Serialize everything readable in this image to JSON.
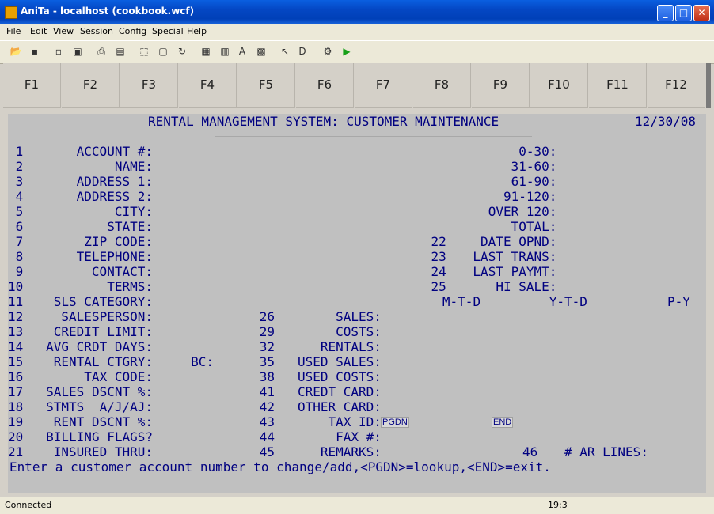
{
  "window": {
    "title": "AniTa -   localhost (cookbook.wcf)"
  },
  "menu": [
    "File",
    "Edit",
    "View",
    "Session",
    "Config",
    "Special",
    "Help"
  ],
  "toolbar_icons": [
    "open-icon",
    "save-icon",
    "copy-icon",
    "paste-icon",
    "print-icon",
    "print-setup-icon",
    "select-icon",
    "text-icon",
    "refresh-icon",
    "keyboard-icon",
    "window-icon",
    "font-icon",
    "grid-icon",
    "help-cursor-icon",
    "dos-icon",
    "settings-icon",
    "run-icon"
  ],
  "fkeys": [
    "F1",
    "F2",
    "F3",
    "F4",
    "F5",
    "F6",
    "F7",
    "F8",
    "F9",
    "F10",
    "F11",
    "F12"
  ],
  "terminal": {
    "title": "RENTAL MANAGEMENT SYSTEM: CUSTOMER MAINTENANCE",
    "date": "12/30/08",
    "left_fields": [
      {
        "num": "1",
        "label": "ACCOUNT #:"
      },
      {
        "num": "2",
        "label": "NAME:"
      },
      {
        "num": "3",
        "label": "ADDRESS 1:"
      },
      {
        "num": "4",
        "label": "ADDRESS 2:"
      },
      {
        "num": "5",
        "label": "CITY:"
      },
      {
        "num": "6",
        "label": "STATE:"
      },
      {
        "num": "7",
        "label": "ZIP CODE:"
      },
      {
        "num": "8",
        "label": "TELEPHONE:"
      },
      {
        "num": "9",
        "label": "CONTACT:"
      },
      {
        "num": "10",
        "label": "TERMS:"
      },
      {
        "num": "11",
        "label": "SLS CATEGORY:"
      },
      {
        "num": "12",
        "label": "SALESPERSON:"
      },
      {
        "num": "13",
        "label": "CREDIT LIMIT:"
      },
      {
        "num": "14",
        "label": "AVG CRDT DAYS:"
      },
      {
        "num": "15",
        "label": "RENTAL CTGRY:"
      },
      {
        "num": "16",
        "label": "TAX CODE:"
      },
      {
        "num": "17",
        "label": "SALES DSCNT %:"
      },
      {
        "num": "18",
        "label": "STMTS  A/J/AJ:"
      },
      {
        "num": "19",
        "label": "RENT DSCNT %:"
      },
      {
        "num": "20",
        "label": "BILLING FLAGS?"
      },
      {
        "num": "21",
        "label": "INSURED THRU:"
      }
    ],
    "bc_label": "BC:",
    "aging": [
      {
        "num": "",
        "label": "0-30:"
      },
      {
        "num": "",
        "label": "31-60:"
      },
      {
        "num": "",
        "label": "61-90:"
      },
      {
        "num": "",
        "label": "91-120:"
      },
      {
        "num": "",
        "label": "OVER 120:"
      },
      {
        "num": "",
        "label": "TOTAL:"
      },
      {
        "num": "22",
        "label": "DATE OPND:"
      },
      {
        "num": "23",
        "label": "LAST TRANS:"
      },
      {
        "num": "24",
        "label": "LAST PAYMT:"
      },
      {
        "num": "25",
        "label": "HI SALE:"
      }
    ],
    "period_headers": [
      "M-T-D",
      "Y-T-D",
      "P-Y"
    ],
    "mid_fields": [
      {
        "num": "26",
        "label": "SALES:"
      },
      {
        "num": "29",
        "label": "COSTS:"
      },
      {
        "num": "32",
        "label": "RENTALS:"
      },
      {
        "num": "35",
        "label": "USED SALES:"
      },
      {
        "num": "38",
        "label": "USED COSTS:"
      },
      {
        "num": "41",
        "label": "CREDT CARD:"
      },
      {
        "num": "42",
        "label": "OTHER CARD:"
      },
      {
        "num": "43",
        "label": "TAX ID:"
      },
      {
        "num": "44",
        "label": "FAX #:"
      },
      {
        "num": "45",
        "label": "REMARKS:"
      }
    ],
    "ar_lines": {
      "num": "46",
      "label": "# AR LINES:"
    },
    "pgdn_button": "PGDN",
    "end_button": "END",
    "prompt": "Enter a customer account number to change/add,<PGDN>=lookup,<END>=exit."
  },
  "status": {
    "connection": "Connected",
    "cursor": "19:3"
  }
}
